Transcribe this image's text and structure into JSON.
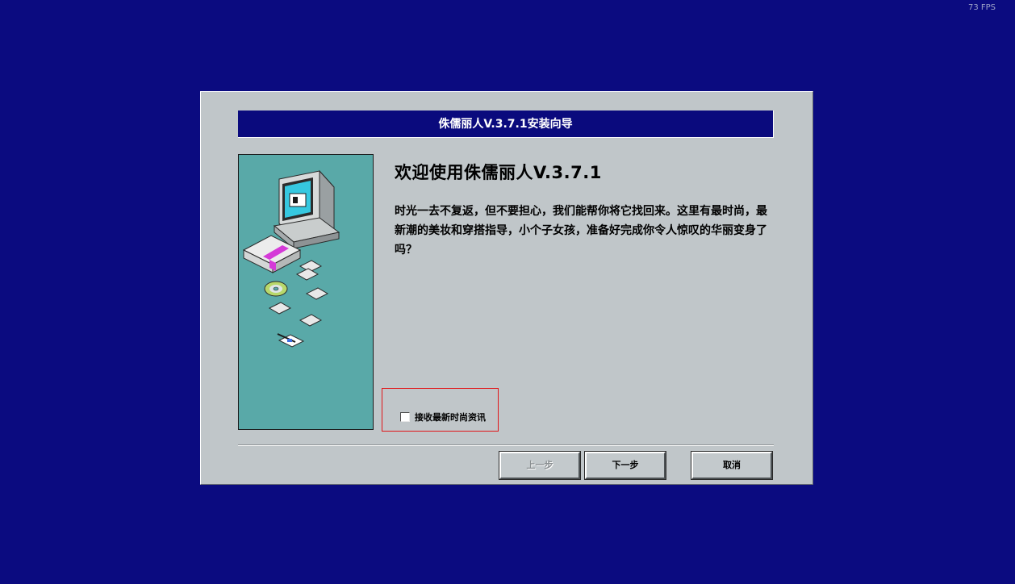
{
  "fps_counter": "73 FPS",
  "dialog": {
    "title": "侏儒丽人V.3.7.1安装向导",
    "heading": "欢迎使用侏儒丽人V.3.7.1",
    "body": "时光一去不复返，但不要担心，我们能帮你将它找回来。这里有最时尚，最新潮的美妆和穿搭指导，小个子女孩，准备好完成你令人惊叹的华丽变身了吗？",
    "checkbox_label": "接收最新时尚资讯",
    "checkbox_checked": false,
    "buttons": {
      "back": "上一步",
      "next": "下一步",
      "cancel": "取消"
    },
    "illustration": "installer-computer-disks-illustration"
  },
  "colors": {
    "desktop": "#0b0b80",
    "titlebar": "#0a0a7d",
    "dialog_bg": "#c0c6c9",
    "side_panel": "#59a9a8",
    "highlight": "#e0161a"
  }
}
